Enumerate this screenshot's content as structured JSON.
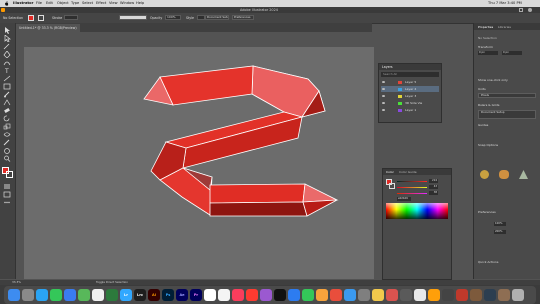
{
  "menubar": {
    "app_name": "Illustrator",
    "items": [
      "File",
      "Edit",
      "Object",
      "Type",
      "Select",
      "Effect",
      "View",
      "Window",
      "Help"
    ],
    "clock": "Thu 7 Mar 3:40 PM"
  },
  "appbar": {
    "title": "Adobe Illustrator 2024"
  },
  "controlbar": {
    "no_selection": "No Selection",
    "stroke_label": "Stroke",
    "opacity_label": "Opacity",
    "opacity_value": "100%",
    "style_label": "Style",
    "doc_setup": "Document Setup",
    "preferences": "Preferences"
  },
  "document": {
    "tab_title": "Untitled-1* @ 33.3 % (RGB/Preview)"
  },
  "layers_panel": {
    "title": "Layers",
    "search_placeholder": "Search All",
    "rows": [
      {
        "name": "Layer 5",
        "color": "#e0463a"
      },
      {
        "name": "Layer 4",
        "color": "#3aa1e0"
      },
      {
        "name": "Layer 3",
        "color": "#e0d43a"
      },
      {
        "name": "3D Side Vie",
        "color": "#4ae03a"
      },
      {
        "name": "Layer 1",
        "color": "#8a4ae0"
      }
    ]
  },
  "color_panel": {
    "tabs": [
      "Color",
      "Color Guide"
    ],
    "r": "224",
    "g": "43",
    "b": "38",
    "hex": "e02b26"
  },
  "properties_panel": {
    "tabs": [
      "Properties",
      "Libraries"
    ],
    "no_selection": "No Selection",
    "transform_label": "Transform",
    "units_label": "Units",
    "units_value": "Pixels",
    "select_same": "Show one-click only",
    "rulers_label": "Rulers & Grids",
    "guides_label": "Guides",
    "snap_label": "Snap Options",
    "preferences_label": "Preferences",
    "quick_actions": "Quick Actions",
    "document_setup": "Document Setup",
    "x_value": "0 px",
    "y_value": "0 px",
    "artwork_label": "Artwork",
    "wide_value": "100%",
    "size_value": "200%"
  },
  "status": {
    "zoom": "33.3%",
    "tool": "Toggle Direct Selection"
  },
  "colors": {
    "accent_red": "#e02b26",
    "canvas_bg": "#535353",
    "artboard": "#6c6c6c"
  },
  "dock": {
    "icons": [
      "finder",
      "launchpad",
      "safari",
      "messages",
      "mail",
      "maps",
      "photos",
      "facetime",
      "calendar",
      "contacts",
      "reminders",
      "notes",
      "lightroom",
      "bridge",
      "lightroom-classic",
      "illustrator",
      "photoshop",
      "after-effects",
      "premiere",
      "music",
      "podcasts",
      "tv",
      "news",
      "keynote",
      "numbers",
      "pages",
      "app-store",
      "settings",
      "trash"
    ]
  }
}
